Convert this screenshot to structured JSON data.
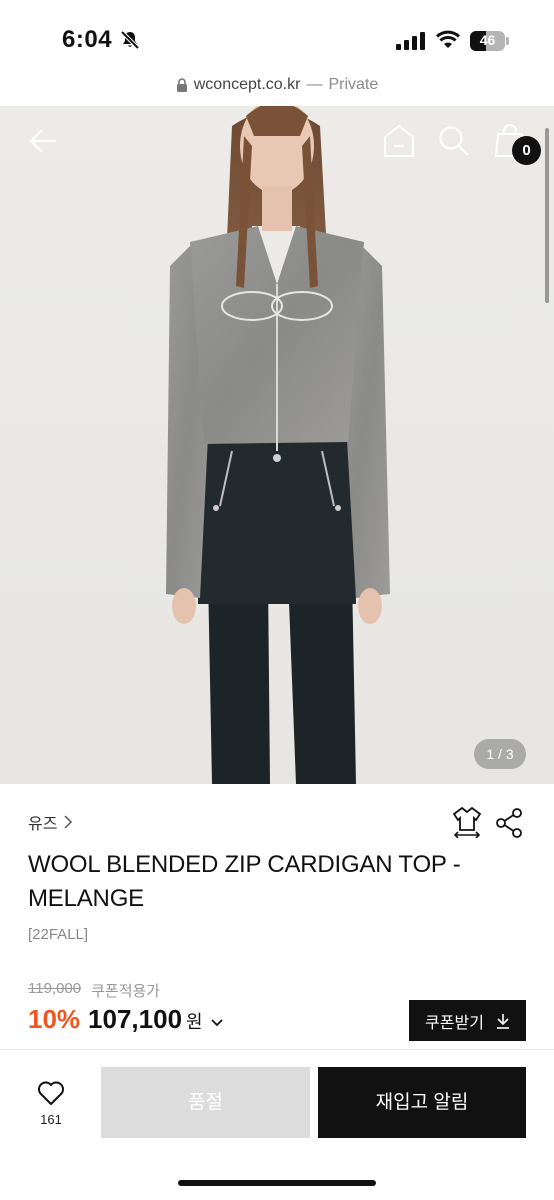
{
  "status_bar": {
    "time": "6:04",
    "battery_level": "46",
    "battery_fraction": 0.46
  },
  "url_bar": {
    "domain": "wconcept.co.kr",
    "separator": "—",
    "mode": "Private"
  },
  "hero": {
    "cart_count": "0",
    "image_counter": "1 / 3",
    "icons": [
      "back-arrow-icon",
      "home-icon",
      "search-icon",
      "shopping-bag-icon"
    ]
  },
  "product": {
    "brand": "유즈",
    "title": "WOOL BLENDED ZIP CARDIGAN TOP - MELANGE",
    "season": "[22FALL]",
    "original_price": "119,000",
    "coupon_applied_label": "쿠폰적용가",
    "discount": "10%",
    "price": "107,100",
    "currency": "원",
    "coupon_button_label": "쿠폰받기"
  },
  "bottom_bar": {
    "wish_count": "161",
    "soldout_label": "품절",
    "restock_label": "재입고 알림"
  },
  "colors": {
    "accent_discount": "#f0561d",
    "primary_black": "#111111",
    "disabled_gray": "#dcdcdc"
  }
}
